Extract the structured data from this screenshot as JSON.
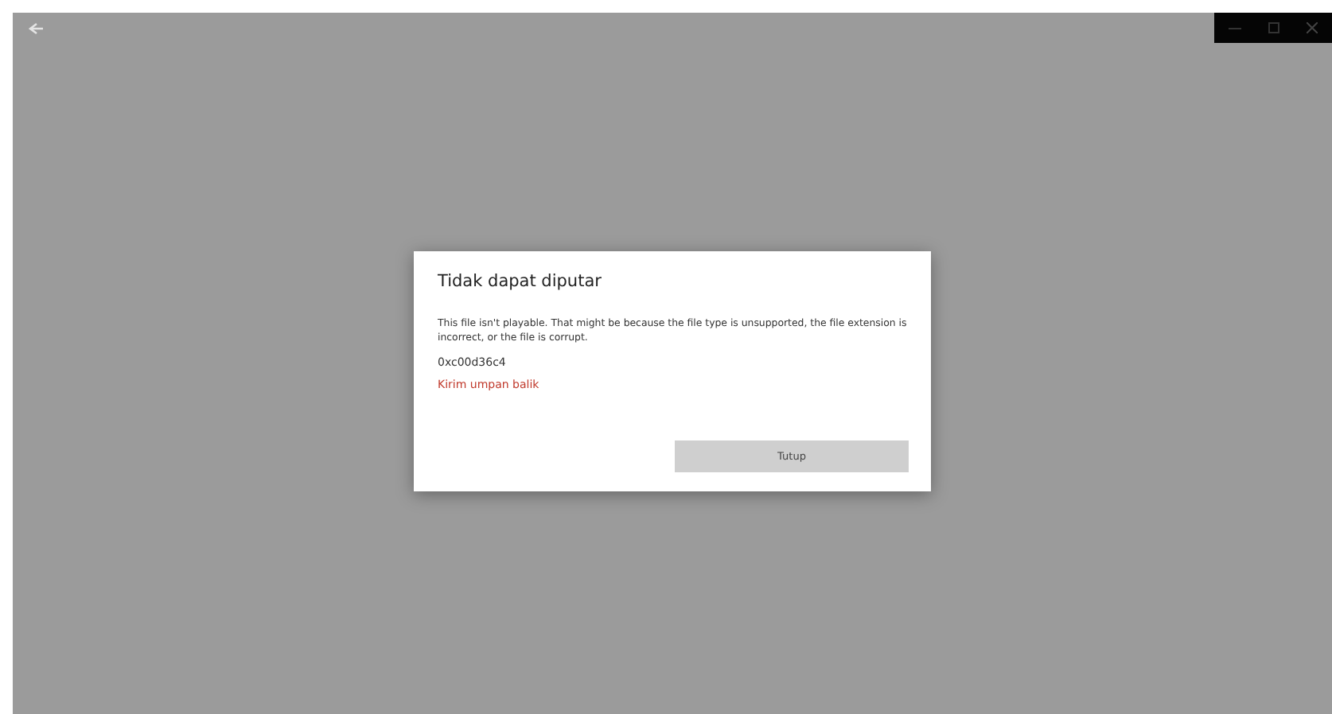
{
  "dialog": {
    "title": "Tidak dapat diputar",
    "message": "This file isn't playable. That might be because the file type is unsupported, the file extension is incorrect, or the file is corrupt.",
    "error_code": "0xc00d36c4",
    "feedback_link": "Kirim umpan balik",
    "buttons": [
      "Tutup"
    ]
  }
}
